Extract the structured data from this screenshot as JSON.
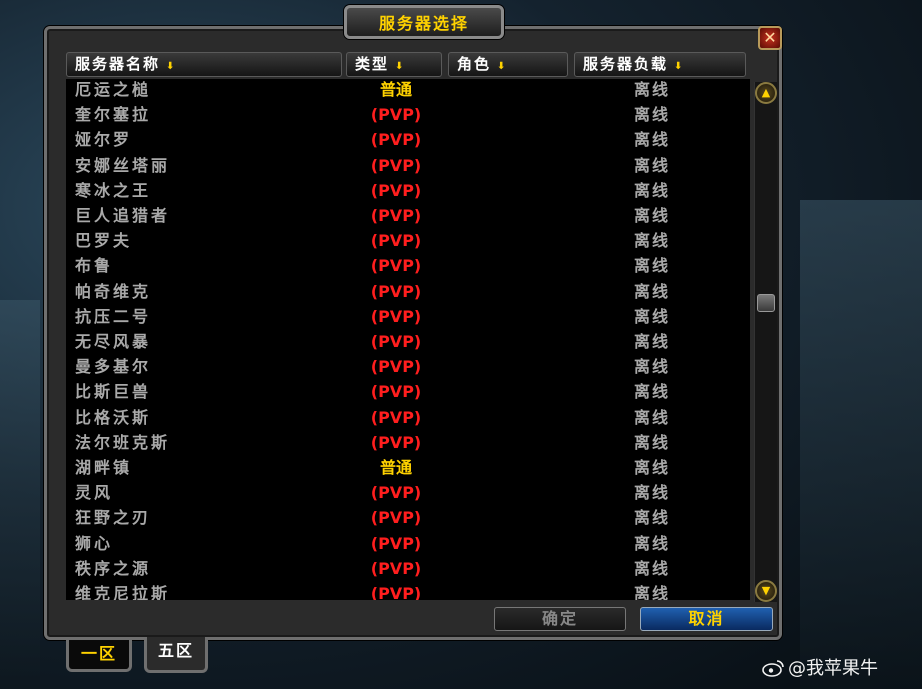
{
  "window": {
    "title": "服务器选择",
    "close_glyph": "✕"
  },
  "columns": [
    {
      "label": "服务器名称"
    },
    {
      "label": "类型"
    },
    {
      "label": "角色"
    },
    {
      "label": "服务器负载"
    }
  ],
  "sort_arrow": "⬇",
  "colors": {
    "normal": "#ffd200",
    "pvp": "#ff1e1e",
    "text_gray": "#a9a9a9"
  },
  "servers": [
    {
      "name": "厄运之槌",
      "type": "普通",
      "type_class": "normal",
      "load": "离线"
    },
    {
      "name": "奎尔塞拉",
      "type": "(PVP)",
      "type_class": "pvp",
      "load": "离线"
    },
    {
      "name": "娅尔罗",
      "type": "(PVP)",
      "type_class": "pvp",
      "load": "离线"
    },
    {
      "name": "安娜丝塔丽",
      "type": "(PVP)",
      "type_class": "pvp",
      "load": "离线"
    },
    {
      "name": "寒冰之王",
      "type": "(PVP)",
      "type_class": "pvp",
      "load": "离线"
    },
    {
      "name": "巨人追猎者",
      "type": "(PVP)",
      "type_class": "pvp",
      "load": "离线"
    },
    {
      "name": "巴罗夫",
      "type": "(PVP)",
      "type_class": "pvp",
      "load": "离线"
    },
    {
      "name": "布鲁",
      "type": "(PVP)",
      "type_class": "pvp",
      "load": "离线"
    },
    {
      "name": "帕奇维克",
      "type": "(PVP)",
      "type_class": "pvp",
      "load": "离线"
    },
    {
      "name": "抗压二号",
      "type": "(PVP)",
      "type_class": "pvp",
      "load": "离线"
    },
    {
      "name": "无尽风暴",
      "type": "(PVP)",
      "type_class": "pvp",
      "load": "离线"
    },
    {
      "name": "曼多基尔",
      "type": "(PVP)",
      "type_class": "pvp",
      "load": "离线"
    },
    {
      "name": "比斯巨兽",
      "type": "(PVP)",
      "type_class": "pvp",
      "load": "离线"
    },
    {
      "name": "比格沃斯",
      "type": "(PVP)",
      "type_class": "pvp",
      "load": "离线"
    },
    {
      "name": "法尔班克斯",
      "type": "(PVP)",
      "type_class": "pvp",
      "load": "离线"
    },
    {
      "name": "湖畔镇",
      "type": "普通",
      "type_class": "normal",
      "load": "离线"
    },
    {
      "name": "灵风",
      "type": "(PVP)",
      "type_class": "pvp",
      "load": "离线"
    },
    {
      "name": "狂野之刃",
      "type": "(PVP)",
      "type_class": "pvp",
      "load": "离线"
    },
    {
      "name": "狮心",
      "type": "(PVP)",
      "type_class": "pvp",
      "load": "离线"
    },
    {
      "name": "秩序之源",
      "type": "(PVP)",
      "type_class": "pvp",
      "load": "离线"
    },
    {
      "name": "维克尼拉斯",
      "type": "(PVP)",
      "type_class": "pvp",
      "load": "离线"
    }
  ],
  "buttons": {
    "ok": "确定",
    "cancel": "取消"
  },
  "tabs": [
    {
      "label": "一区"
    },
    {
      "label": "五区"
    }
  ],
  "watermark": {
    "text": "@我苹果牛",
    "icon": "weibo-icon"
  }
}
